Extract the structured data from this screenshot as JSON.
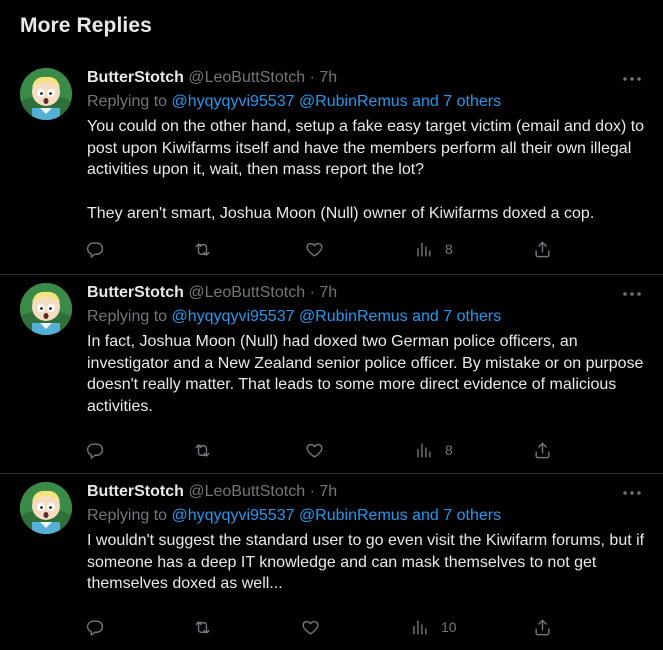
{
  "section": {
    "title": "More Replies"
  },
  "colors": {
    "background": "#000000",
    "text": "#e7e9ea",
    "muted": "#71767b",
    "accent": "#1d9bf0",
    "divider": "#2f3336"
  },
  "icons": {
    "reply": "reply-icon",
    "retweet": "retweet-icon",
    "like": "heart-icon",
    "views": "views-icon",
    "share": "share-icon",
    "more": "more-icon"
  },
  "replies": [
    {
      "author": {
        "name": "ButterStotch",
        "handle": "@LeoButtStotch",
        "sep": "·",
        "time": "7h"
      },
      "replying_label": "Replying to ",
      "mentions": [
        "@hyqyqyvi95537",
        "@RubinRemus",
        "and 7 others"
      ],
      "paragraphs": [
        "You could on the other hand, setup a fake easy target victim (email and dox) to post upon Kiwifarms itself and have the members perform all their own illegal activities upon it, wait, then mass report the lot?",
        "They aren't smart, Joshua Moon (Null) owner of Kiwifarms doxed a cop."
      ],
      "views": "8"
    },
    {
      "author": {
        "name": "ButterStotch",
        "handle": "@LeoButtStotch",
        "sep": "·",
        "time": "7h"
      },
      "replying_label": "Replying to ",
      "mentions": [
        "@hyqyqyvi95537",
        "@RubinRemus",
        "and 7 others"
      ],
      "paragraphs": [
        "In fact, Joshua Moon (Null) had doxed two German police officers, an investigator and a New Zealand senior police officer. By mistake or on purpose doesn't really matter. That leads to some more direct evidence of malicious activities."
      ],
      "views": "8"
    },
    {
      "author": {
        "name": "ButterStotch",
        "handle": "@LeoButtStotch",
        "sep": "·",
        "time": "7h"
      },
      "replying_label": "Replying to ",
      "mentions": [
        "@hyqyqyvi95537",
        "@RubinRemus",
        "and 7 others"
      ],
      "paragraphs": [
        "I wouldn't suggest the standard user to go even visit the Kiwifarm forums, but if someone has a deep IT knowledge and can mask themselves to not get themselves doxed as well..."
      ],
      "views": "10"
    }
  ]
}
